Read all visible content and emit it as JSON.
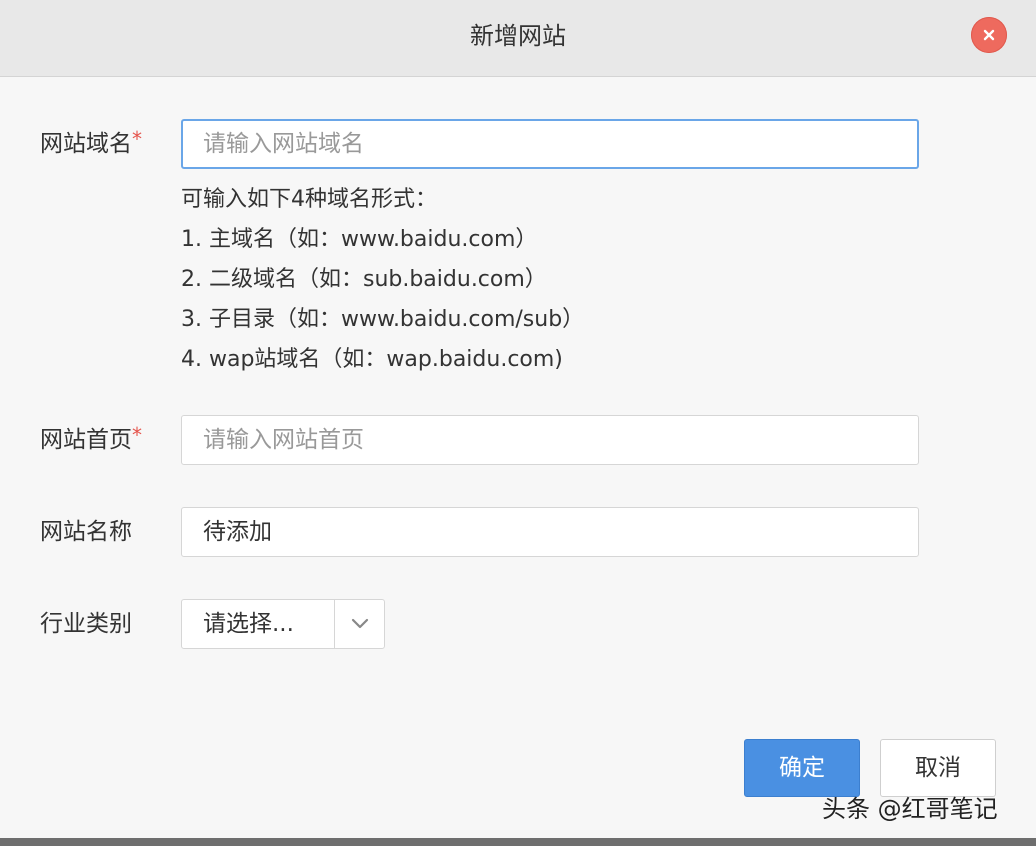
{
  "dialog": {
    "title": "新增网站",
    "close_icon": "close-icon"
  },
  "form": {
    "domain": {
      "label": "网站域名",
      "required_mark": "*",
      "placeholder": "请输入网站域名",
      "value": ""
    },
    "hints": {
      "intro": "可输入如下4种域名形式：",
      "items": [
        "1. 主域名（如：www.baidu.com）",
        "2. 二级域名（如：sub.baidu.com）",
        "3. 子目录（如：www.baidu.com/sub）",
        "4. wap站域名（如：wap.baidu.com)"
      ]
    },
    "homepage": {
      "label": "网站首页",
      "required_mark": "*",
      "placeholder": "请输入网站首页",
      "value": ""
    },
    "site_name": {
      "label": "网站名称",
      "value": "待添加"
    },
    "industry": {
      "label": "行业类别",
      "selected": "请选择...",
      "arrow_icon": "chevron-down-icon"
    }
  },
  "buttons": {
    "ok": "确定",
    "cancel": "取消"
  },
  "watermark": "头条 @红哥笔记",
  "colors": {
    "primary": "#4a90e2",
    "close": "#ee6a5e",
    "required": "#e5534b",
    "focus_border": "#6aa6e8"
  }
}
